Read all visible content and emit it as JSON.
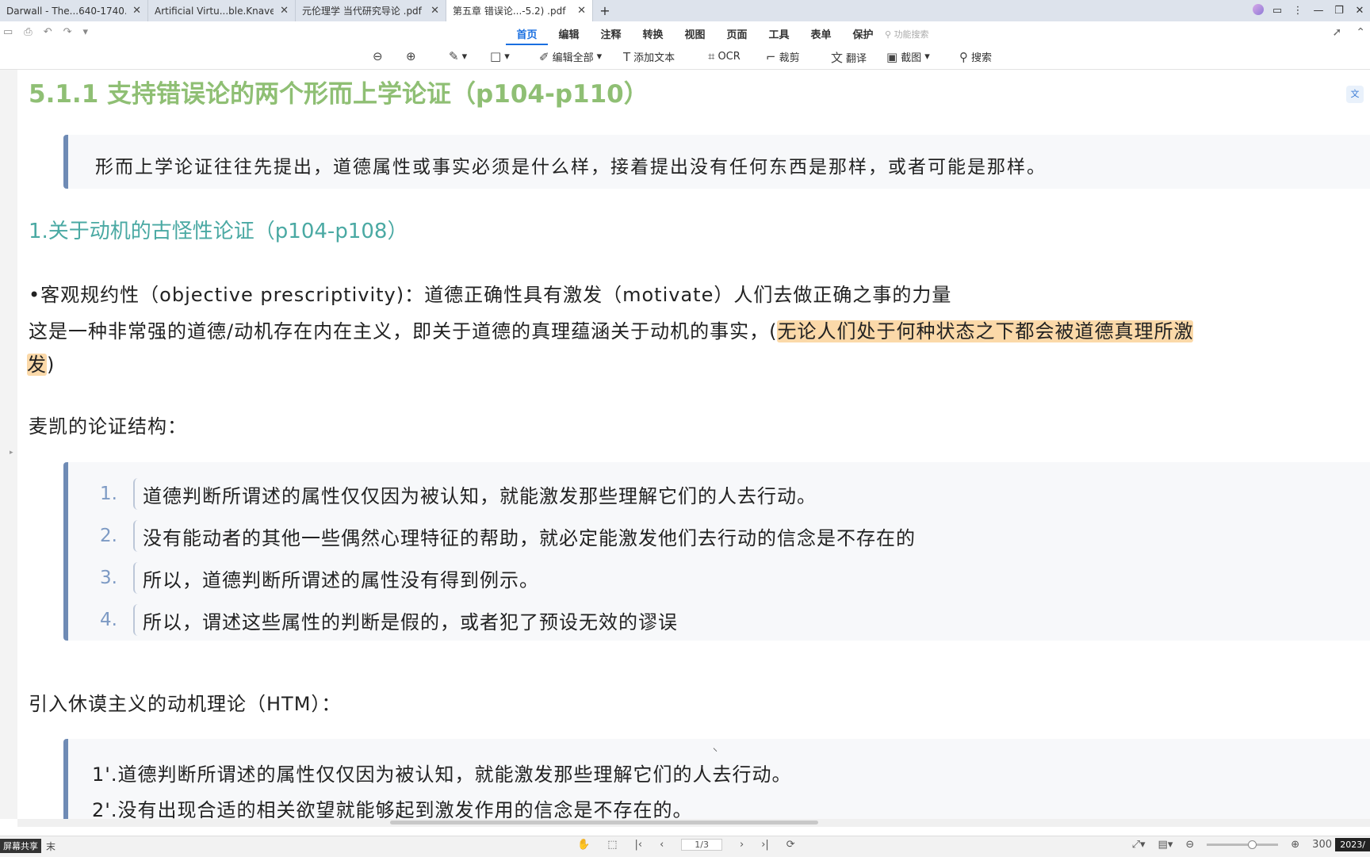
{
  "tabs": [
    {
      "title": "Darwall - The...640-1740.pdf",
      "active": false
    },
    {
      "title": "Artificial Virtu...ble.Knave.pdf",
      "active": false
    },
    {
      "title": "元伦理学 当代研究导论 .pdf ...",
      "active": false
    },
    {
      "title": "第五章 错误论...-5.2) .pdf",
      "active": true
    }
  ],
  "menu": [
    "首页",
    "编辑",
    "注释",
    "转换",
    "视图",
    "页面",
    "工具",
    "表单",
    "保护"
  ],
  "menu_active": "首页",
  "menu_search": "功能搜索",
  "toolbar": {
    "edit_all": "编辑全部",
    "add_text": "添加文本",
    "ocr": "OCR",
    "crop": "裁剪",
    "translate": "翻译",
    "screenshot": "截图",
    "search": "搜索"
  },
  "doc": {
    "heading1": "5.1.1 支持错误论的两个形而上学论证（p104-p110）",
    "quote1": "形而上学论证往往先提出，道德属性或事实必须是什么样，接着提出没有任何东西是那样，或者可能是那样。",
    "heading2": "1.关于动机的古怪性论证（p104-p108）",
    "bullet": "•客观规约性（objective prescriptivity)：道德正确性具有激发（motivate）人们去做正确之事的力量",
    "para1_plain": "这是一种非常强的道德/动机存在内在主义，即关于道德的真理蕴涵关于动机的事实，(",
    "para1_highlight": "无论人们处于何种状态之下都会被道德真理所激",
    "para2_highlight": "发",
    "para2_tail": ")",
    "mackie_label": "麦凯的论证结构：",
    "mackie_list": [
      {
        "num": "1.",
        "text": "道德判断所谓述的属性仅仅因为被认知，就能激发那些理解它们的人去行动。"
      },
      {
        "num": "2.",
        "text": "没有能动者的其他一些偶然心理特征的帮助，就必定能激发他们去行动的信念是不存在的"
      },
      {
        "num": "3.",
        "text": "所以，道德判断所谓述的属性没有得到例示。"
      },
      {
        "num": "4.",
        "text": "所以，谓述这些属性的判断是假的，或者犯了预设无效的谬误"
      }
    ],
    "htm_label": "引入休谟主义的动机理论（HTM）：",
    "htm_list": [
      "1'.道德判断所谓述的属性仅仅因为被认知，就能激发那些理解它们的人去行动。",
      "2'.没有出现合适的相关欲望就能够起到激发作用的信念是不存在的。"
    ]
  },
  "status": {
    "left_tag": "屏幕共享",
    "left_text": "末",
    "page": "1/3",
    "zoom": "300",
    "year": "2023/"
  }
}
